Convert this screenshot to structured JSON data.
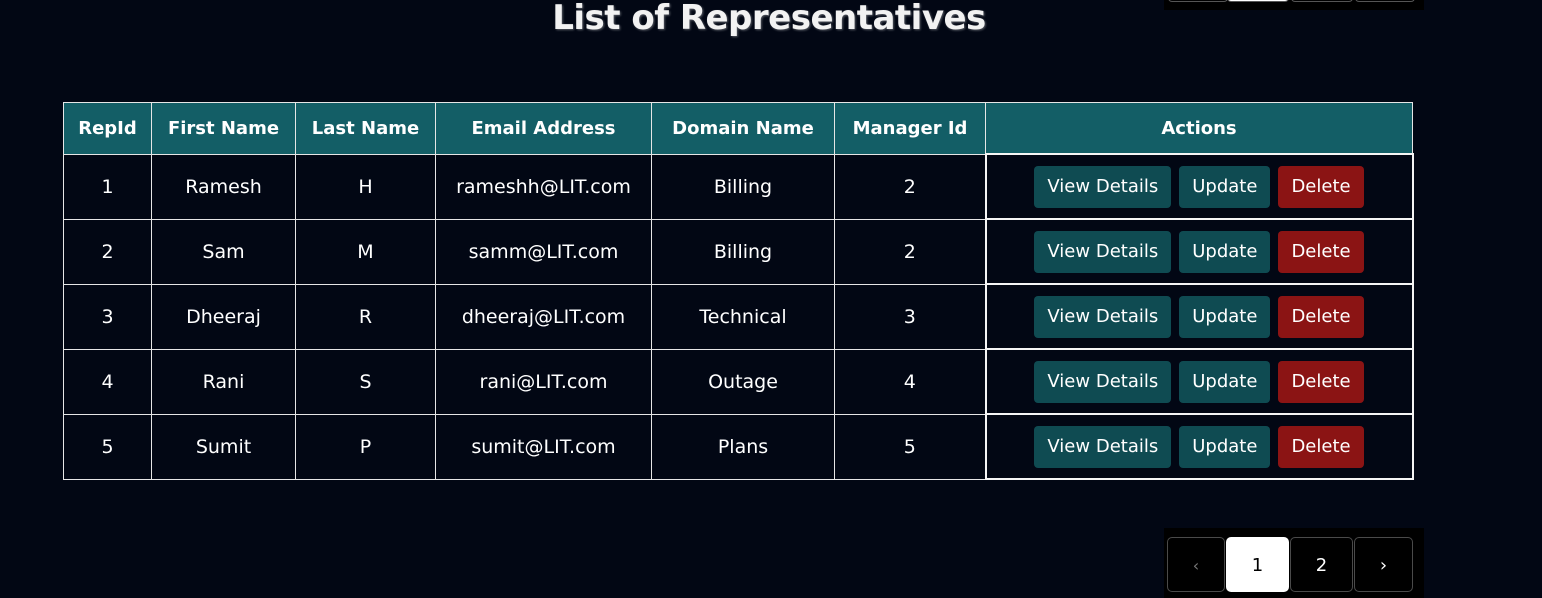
{
  "title": "List of Representatives",
  "table": {
    "headers": [
      "RepId",
      "First Name",
      "Last Name",
      "Email Address",
      "Domain Name",
      "Manager Id",
      "Actions"
    ],
    "rows": [
      {
        "id": "1",
        "first": "Ramesh",
        "last": "H",
        "email": "rameshh@LIT.com",
        "domain": "Billing",
        "manager": "2"
      },
      {
        "id": "2",
        "first": "Sam",
        "last": "M",
        "email": "samm@LIT.com",
        "domain": "Billing",
        "manager": "2"
      },
      {
        "id": "3",
        "first": "Dheeraj",
        "last": "R",
        "email": "dheeraj@LIT.com",
        "domain": "Technical",
        "manager": "3"
      },
      {
        "id": "4",
        "first": "Rani",
        "last": "S",
        "email": "rani@LIT.com",
        "domain": "Outage",
        "manager": "4"
      },
      {
        "id": "5",
        "first": "Sumit",
        "last": "P",
        "email": "sumit@LIT.com",
        "domain": "Plans",
        "manager": "5"
      }
    ],
    "actions": {
      "view_label": "View Details",
      "update_label": "Update",
      "delete_label": "Delete"
    }
  },
  "pagination": {
    "prev": "‹",
    "pages": [
      "1",
      "2"
    ],
    "current": "1",
    "next": "›"
  },
  "colors": {
    "background": "#020714",
    "header": "#135e66",
    "action_button": "#0f4b52",
    "delete_button": "#8b1414"
  }
}
